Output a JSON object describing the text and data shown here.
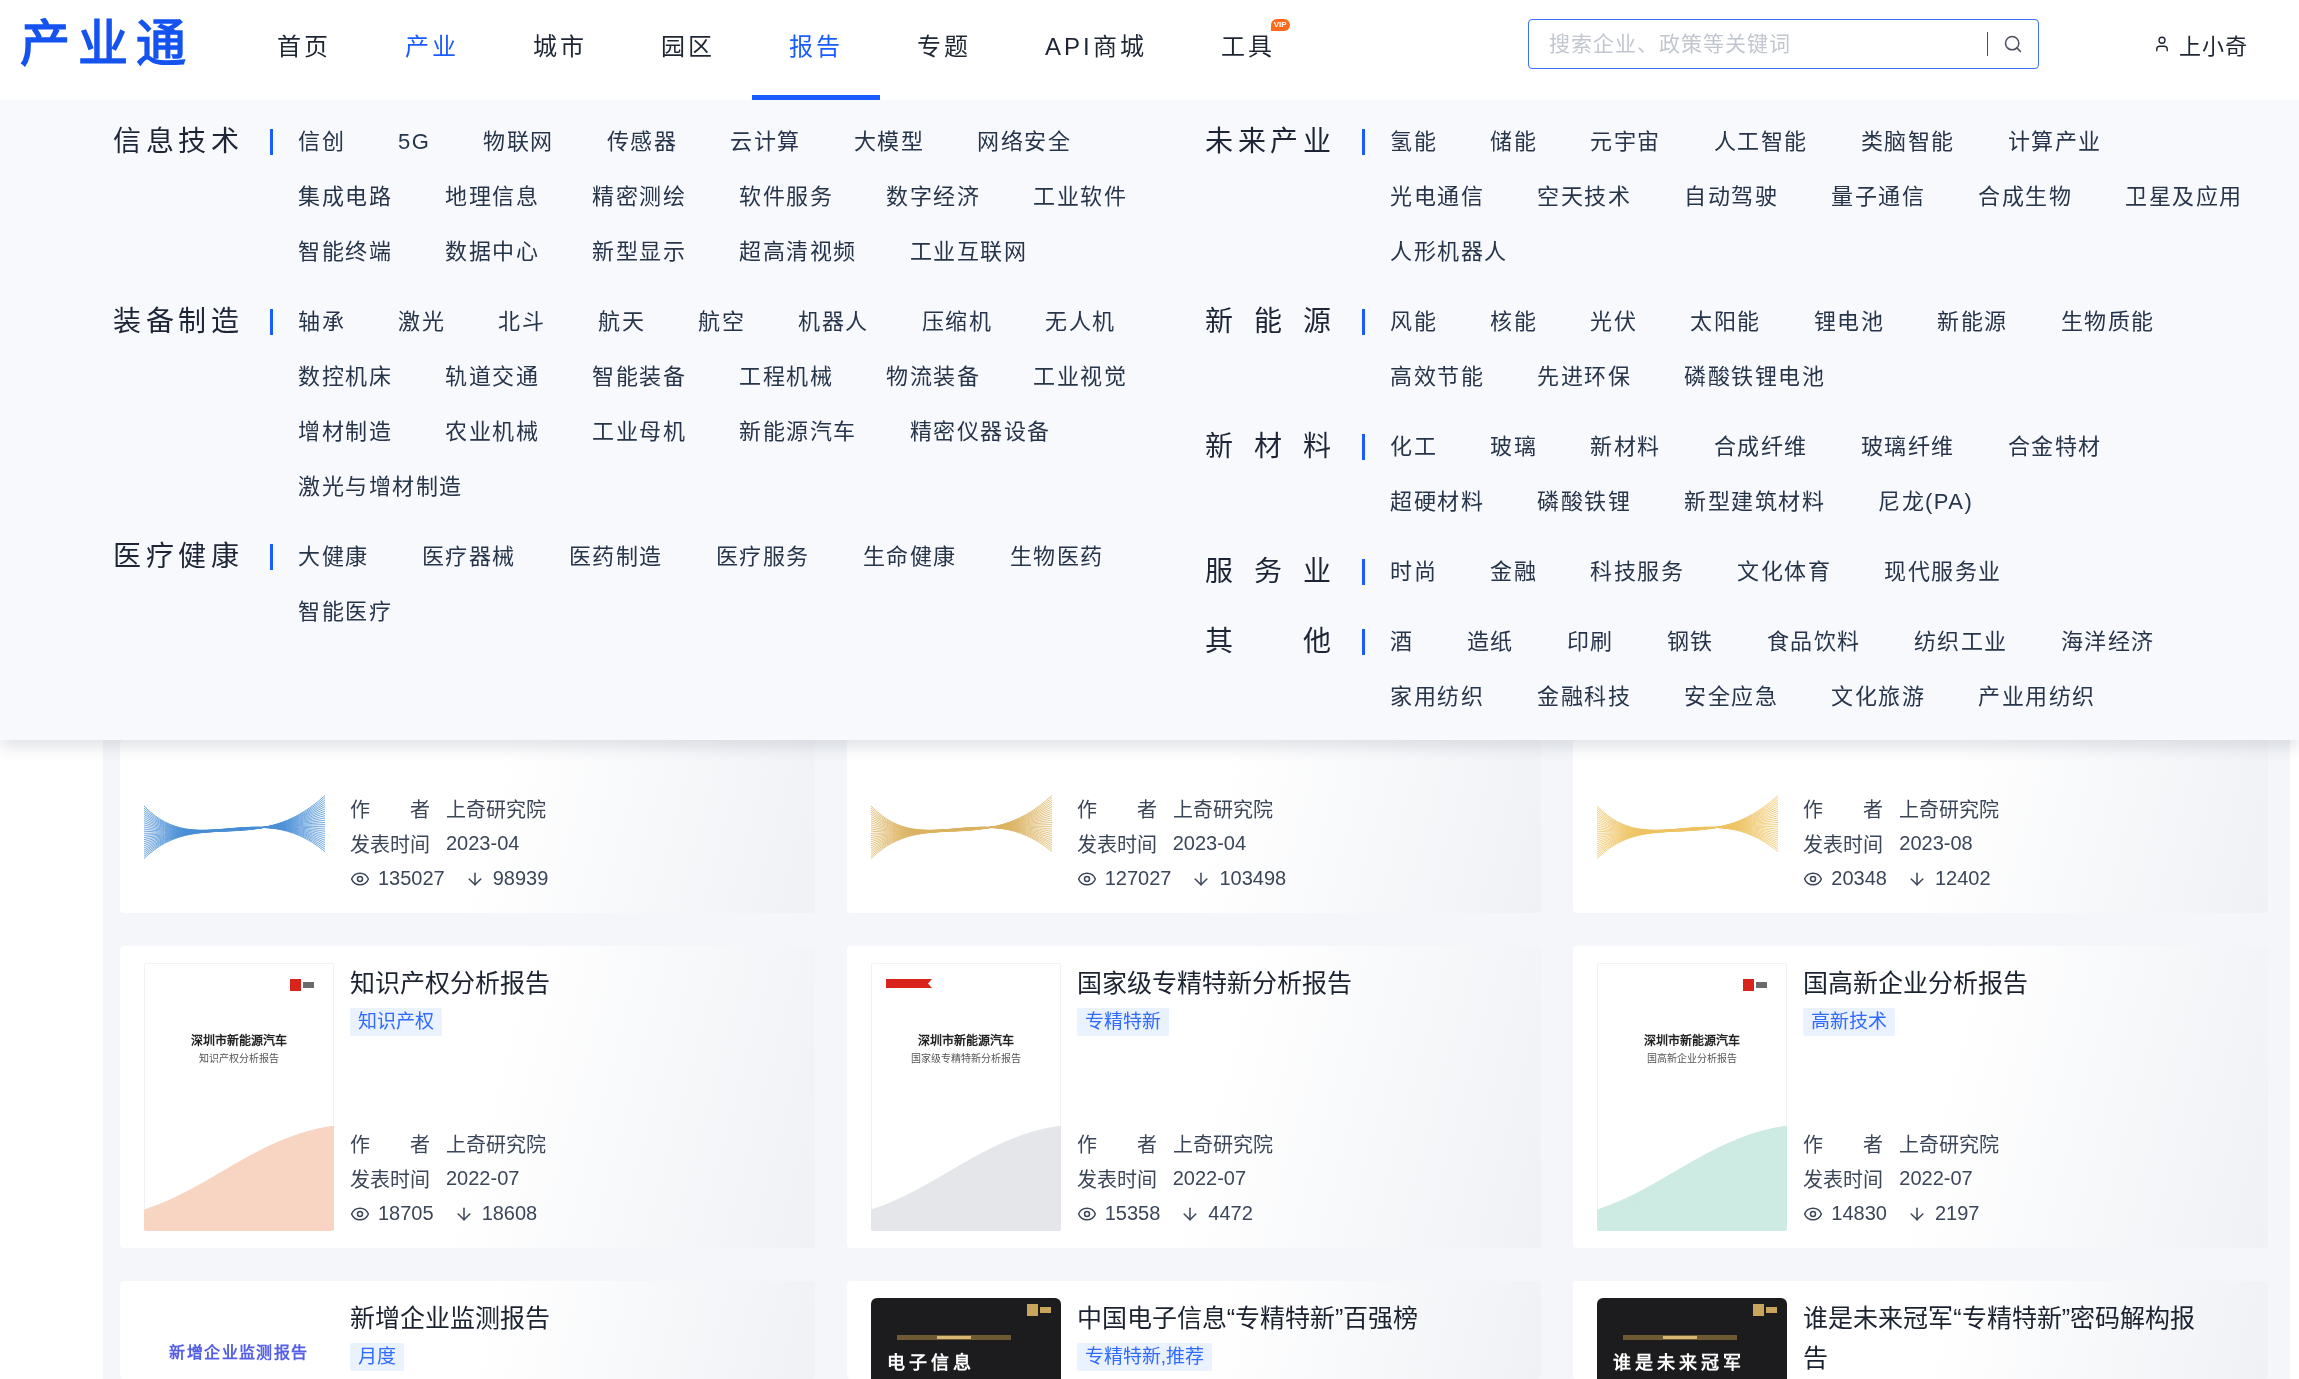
{
  "header": {
    "logo": "产业通",
    "nav": [
      {
        "label": "首页",
        "selected": false,
        "open": false
      },
      {
        "label": "产业",
        "selected": false,
        "open": true
      },
      {
        "label": "城市",
        "selected": false,
        "open": false
      },
      {
        "label": "园区",
        "selected": false,
        "open": false
      },
      {
        "label": "报告",
        "selected": true,
        "open": false
      },
      {
        "label": "专题",
        "selected": false,
        "open": false
      },
      {
        "label": "API商城",
        "selected": false,
        "open": false
      },
      {
        "label": "工具",
        "selected": false,
        "open": false,
        "badge": "VIP"
      }
    ],
    "search": {
      "placeholder": "搜索企业、政策等关键词"
    },
    "user": {
      "name": "上小奇"
    }
  },
  "industry_menu": {
    "columns": [
      {
        "groups": [
          {
            "label": "信息技术",
            "lines": [
              [
                "信创",
                "5G",
                "物联网",
                "传感器",
                "云计算",
                "大模型",
                "网络安全"
              ],
              [
                "集成电路",
                "地理信息",
                "精密测绘",
                "软件服务",
                "数字经济",
                "工业软件"
              ],
              [
                "智能终端",
                "数据中心",
                "新型显示",
                "超高清视频",
                "工业互联网"
              ]
            ]
          },
          {
            "label": "装备制造",
            "lines": [
              [
                "轴承",
                "激光",
                "北斗",
                "航天",
                "航空",
                "机器人",
                "压缩机",
                "无人机"
              ],
              [
                "数控机床",
                "轨道交通",
                "智能装备",
                "工程机械",
                "物流装备",
                "工业视觉"
              ],
              [
                "增材制造",
                "农业机械",
                "工业母机",
                "新能源汽车",
                "精密仪器设备"
              ],
              [
                "激光与增材制造"
              ]
            ]
          },
          {
            "label": "医疗健康",
            "lines": [
              [
                "大健康",
                "医疗器械",
                "医药制造",
                "医疗服务",
                "生命健康",
                "生物医药"
              ],
              [
                "智能医疗"
              ]
            ]
          }
        ]
      },
      {
        "groups": [
          {
            "label": "未来产业",
            "lines": [
              [
                "氢能",
                "储能",
                "元宇宙",
                "人工智能",
                "类脑智能",
                "计算产业"
              ],
              [
                "光电通信",
                "空天技术",
                "自动驾驶",
                "量子通信",
                "合成生物",
                "卫星及应用"
              ],
              [
                "人形机器人"
              ]
            ]
          },
          {
            "label": "新能源",
            "lines": [
              [
                "风能",
                "核能",
                "光伏",
                "太阳能",
                "锂电池",
                "新能源",
                "生物质能"
              ],
              [
                "高效节能",
                "先进环保",
                "磷酸铁锂电池"
              ]
            ]
          },
          {
            "label": "新材料",
            "lines": [
              [
                "化工",
                "玻璃",
                "新材料",
                "合成纤维",
                "玻璃纤维",
                "合金特材"
              ],
              [
                "超硬材料",
                "磷酸铁锂",
                "新型建筑材料",
                "尼龙(PA)"
              ]
            ]
          },
          {
            "label": "服务业",
            "lines": [
              [
                "时尚",
                "金融",
                "科技服务",
                "文化体育",
                "现代服务业"
              ]
            ]
          },
          {
            "label": "其他",
            "lines": [
              [
                "酒",
                "造纸",
                "印刷",
                "钢铁",
                "食品饮料",
                "纺织工业",
                "海洋经济"
              ],
              [
                "家用纺织",
                "金融科技",
                "安全应急",
                "文化旅游",
                "产业用纺织"
              ]
            ]
          }
        ]
      }
    ]
  },
  "reports": {
    "rows": [
      {
        "cards": [
          {
            "cover": {
              "kind": "wave",
              "color": "#4a8fd6"
            },
            "meta": [
              {
                "label": "作者",
                "value": "上奇研究院"
              },
              {
                "label": "发表时间",
                "value": "2023-04"
              }
            ],
            "views": "135027",
            "downloads": "98939"
          },
          {
            "cover": {
              "kind": "wave",
              "color": "#dcb462"
            },
            "meta": [
              {
                "label": "作者",
                "value": "上奇研究院"
              },
              {
                "label": "发表时间",
                "value": "2023-04"
              }
            ],
            "views": "127027",
            "downloads": "103498"
          },
          {
            "cover": {
              "kind": "wave",
              "color": "#efc463"
            },
            "meta": [
              {
                "label": "作者",
                "value": "上奇研究院"
              },
              {
                "label": "发表时间",
                "value": "2023-08"
              }
            ],
            "views": "20348",
            "downloads": "12402"
          }
        ]
      },
      {
        "cards": [
          {
            "cover": {
              "kind": "report",
              "logo": true,
              "ribbon": false,
              "title": "深圳市新能源汽车",
              "subtitle": "知识产权分析报告",
              "color": "#f8d5c2"
            },
            "title": "知识产权分析报告",
            "tags": [
              "知识产权"
            ],
            "meta": [
              {
                "label": "作者",
                "value": "上奇研究院"
              },
              {
                "label": "发表时间",
                "value": "2022-07"
              }
            ],
            "views": "18705",
            "downloads": "18608"
          },
          {
            "cover": {
              "kind": "report",
              "logo": false,
              "ribbon": true,
              "title": "深圳市新能源汽车",
              "subtitle": "国家级专精特新分析报告",
              "color": "#e4e6ea"
            },
            "title": "国家级专精特新分析报告",
            "tags": [
              "专精特新"
            ],
            "meta": [
              {
                "label": "作者",
                "value": "上奇研究院"
              },
              {
                "label": "发表时间",
                "value": "2022-07"
              }
            ],
            "views": "15358",
            "downloads": "4472"
          },
          {
            "cover": {
              "kind": "report",
              "logo": true,
              "ribbon": false,
              "title": "深圳市新能源汽车",
              "subtitle": "国高新企业分析报告",
              "color": "#cdeae3"
            },
            "title": "国高新企业分析报告",
            "tags": [
              "高新技术"
            ],
            "meta": [
              {
                "label": "作者",
                "value": "上奇研究院"
              },
              {
                "label": "发表时间",
                "value": "2022-07"
              }
            ],
            "views": "14830",
            "downloads": "2197"
          }
        ]
      },
      {
        "cards": [
          {
            "cover": {
              "kind": "light",
              "title": "新增企业监测报告"
            },
            "title": "新增企业监测报告",
            "tags": [
              "月度"
            ]
          },
          {
            "cover": {
              "kind": "dark",
              "logo": true,
              "title": "电子信息"
            },
            "title": "中国电子信息“专精特新”百强榜",
            "tags": [
              "专精特新,推荐"
            ]
          },
          {
            "cover": {
              "kind": "dark",
              "logo": true,
              "title": "谁是未来冠军"
            },
            "title": "谁是未来冠军“专精特新”密码解构报告"
          }
        ]
      }
    ]
  }
}
